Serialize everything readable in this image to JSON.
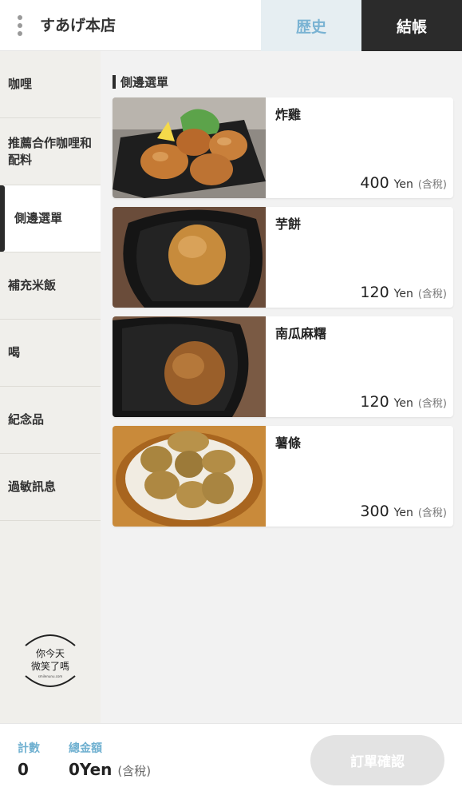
{
  "header": {
    "store_name": "すあげ本店",
    "history_label": "歴史",
    "checkout_label": "結帳"
  },
  "sidebar": {
    "categories": [
      {
        "label": "咖哩"
      },
      {
        "label": "推薦合作咖哩和配料"
      },
      {
        "label": "側邊選單"
      },
      {
        "label": "補充米飯"
      },
      {
        "label": "喝"
      },
      {
        "label": "紀念品"
      },
      {
        "label": "過敏訊息"
      }
    ],
    "active_index": 2,
    "watermark_text": "你今天 微笑了嗎",
    "watermark_small": "smilenunu.com"
  },
  "main": {
    "section_title": "側邊選單",
    "items": [
      {
        "name": "炸雞",
        "price": "400",
        "currency": "Yen",
        "tax_note": "(含稅)",
        "photo": "fried-chicken"
      },
      {
        "name": "芋餅",
        "price": "120",
        "currency": "Yen",
        "tax_note": "(含稅)",
        "photo": "taro-cake"
      },
      {
        "name": "南瓜麻糬",
        "price": "120",
        "currency": "Yen",
        "tax_note": "(含稅)",
        "photo": "pumpkin-mochi"
      },
      {
        "name": "薯條",
        "price": "300",
        "currency": "Yen",
        "tax_note": "(含稅)",
        "photo": "potatoes"
      }
    ]
  },
  "footer": {
    "count_label": "計數",
    "count_value": "0",
    "total_label": "總金額",
    "total_value": "0Yen",
    "total_tax": "(含稅)",
    "confirm_label": "訂單確認"
  },
  "colors": {
    "accent": "#7ab3d3",
    "dark": "#2b2b2b",
    "sidebar_bg": "#f0efeb",
    "main_bg": "#f2f2f2",
    "disabled_button": "#e3e3e3"
  }
}
